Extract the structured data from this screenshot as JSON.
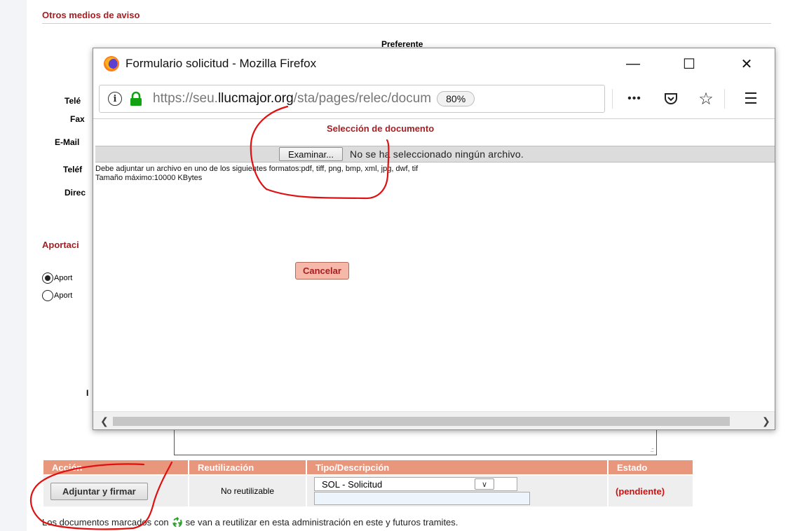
{
  "background": {
    "section_other_notice": "Otros medios de aviso",
    "preferente_label": "Preferente",
    "field_labels": [
      "Telé",
      "Fax",
      "E-Mail",
      "Teléf",
      "Direc"
    ],
    "section_contribution": "Aportaci",
    "radio_options": [
      {
        "label": "Aport",
        "checked": true
      },
      {
        "label": "Aport",
        "checked": false
      }
    ],
    "hidden_label_fragment": "I",
    "documents_table": {
      "headers": [
        "Acción",
        "Reutilización",
        "Tipo/Descripción",
        "Estado"
      ],
      "row": {
        "action_button": "Adjuntar y firmar",
        "reuse": "No reutilizable",
        "type_selected": "SOL - Solicitud",
        "description_value": "",
        "status": "(pendiente)"
      }
    },
    "footnote_before": "Los documentos marcados con",
    "footnote_after": "se van a reutilizar en esta administración en este y futuros tramites."
  },
  "popup": {
    "window_title": "Formulario solicitud - Mozilla Firefox",
    "window_controls": {
      "minimize": "—",
      "maximize": "☐",
      "close": "✕"
    },
    "url": {
      "prefix": "https://seu.",
      "domain": "llucmajor.org",
      "path": "/sta/pages/relec/docum"
    },
    "zoom": "80%",
    "toolbar_icons": [
      "more-icon",
      "pocket-icon",
      "bookmark-star-icon",
      "menu-icon"
    ],
    "heading": "Selección de documento",
    "browse_button": "Examinar...",
    "no_file_text": "No se ha seleccionado ningún archivo.",
    "formats_text": "Debe adjuntar un archivo en uno de los siguientes formatos:pdf, tiff, png, bmp, xml, jpg, dwf, tif",
    "max_size_text": "Tamaño máximo:10000 KBytes",
    "cancel_button": "Cancelar"
  },
  "colors": {
    "section_red": "#a51e22",
    "table_header": "#e8967c",
    "cancel_bg": "#f6b8a8",
    "pending_red": "#d01010",
    "annotation_red": "#e01010"
  }
}
